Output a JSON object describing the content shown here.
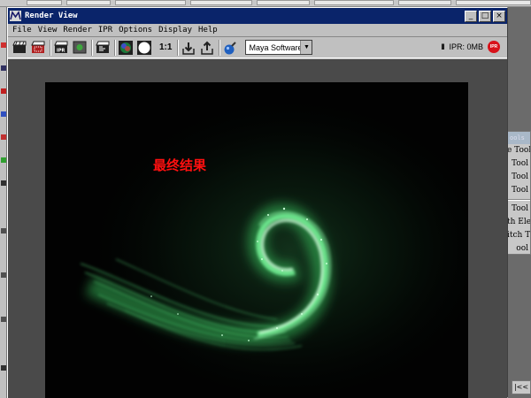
{
  "window": {
    "title": "Render View",
    "minimize": "_",
    "maximize": "□",
    "close": "×"
  },
  "menubar": {
    "items": [
      "File",
      "View",
      "Render",
      "IPR",
      "Options",
      "Display",
      "Help"
    ]
  },
  "toolbar": {
    "ratio_label": "1:1",
    "renderer": "Maya Software",
    "ipr_label": "IPR: 0MB",
    "ipr_icon_text": "IPR",
    "pause_glyph": "II"
  },
  "image": {
    "caption": "最终结果",
    "caption_color": "#ff1010",
    "glow_color": "#4ef57a"
  },
  "tool_panel": {
    "header": "ools",
    "items": [
      "e Tool",
      "Tool",
      "Tool",
      "Tool",
      "Tool",
      "th Ele",
      "itch T",
      "ool"
    ]
  },
  "corner": {
    "label": "|<<"
  }
}
